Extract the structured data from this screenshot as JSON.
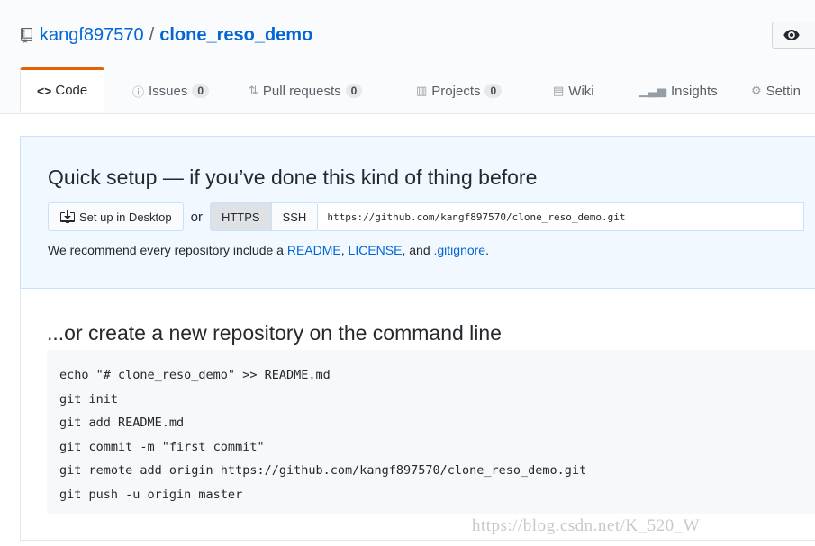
{
  "header": {
    "owner": "kangf897570",
    "separator": "/",
    "repo_name": "clone_reso_demo",
    "watch_icon": "eye-icon"
  },
  "tabs": [
    {
      "label": "Code",
      "icon": "code-icon",
      "selected": true
    },
    {
      "label": "Issues",
      "icon": "issue-opened-icon",
      "count": "0"
    },
    {
      "label": "Pull requests",
      "icon": "git-pull-request-icon",
      "count": "0"
    },
    {
      "label": "Projects",
      "icon": "project-icon",
      "count": "0"
    },
    {
      "label": "Wiki",
      "icon": "book-icon"
    },
    {
      "label": "Insights",
      "icon": "graph-icon"
    },
    {
      "label": "Settin",
      "icon": "gear-icon"
    }
  ],
  "quick_setup": {
    "title": "Quick setup — if you’ve done this kind of thing before",
    "desktop_button": "Set up in Desktop",
    "or": "or",
    "https": "HTTPS",
    "ssh": "SSH",
    "url": "https://github.com/kangf897570/clone_reso_demo.git",
    "recommend_prefix": "We recommend every repository include a",
    "readme": "README",
    "comma1": ",",
    "license": "LICENSE",
    "and": ", and",
    "gitignore": ".gitignore",
    "period": "."
  },
  "command_line": {
    "title": "...or create a new repository on the command line",
    "lines": [
      "echo \"# clone_reso_demo\" >> README.md",
      "git init",
      "git add README.md",
      "git commit -m \"first commit\"",
      "git remote add origin https://github.com/kangf897570/clone_reso_demo.git",
      "git push -u origin master"
    ]
  },
  "watermark": "https://blog.csdn.net/K_520_W",
  "colors": {
    "link": "#0366d6",
    "selected_tab_border": "#e36209",
    "quick_setup_bg": "#f1f8ff"
  }
}
